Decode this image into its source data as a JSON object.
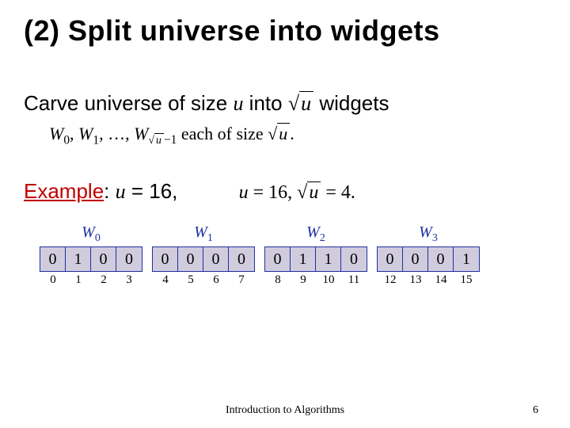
{
  "title": "(2) Split universe into widgets",
  "line1": {
    "pre": "Carve universe of size ",
    "u": "u",
    "mid": " into ",
    "sqrt_arg": "u",
    "post": " widgets"
  },
  "line2": {
    "w": "W",
    "sep": ", ",
    "ellipsis": "…",
    "each": " each of size ",
    "sqrt_arg": "u",
    "period": "."
  },
  "example": {
    "label": "Example",
    "colon": ": ",
    "u": "u",
    "eq": " = 16,",
    "tail_u": "u",
    "tail_eq": " = 16, ",
    "tail_sqrt_arg": "u",
    "tail_eq2": " = 4."
  },
  "widgets": [
    {
      "label_sub": "0",
      "values": [
        "0",
        "1",
        "0",
        "0"
      ],
      "indices": [
        "0",
        "1",
        "2",
        "3"
      ]
    },
    {
      "label_sub": "1",
      "values": [
        "0",
        "0",
        "0",
        "0"
      ],
      "indices": [
        "4",
        "5",
        "6",
        "7"
      ]
    },
    {
      "label_sub": "2",
      "values": [
        "0",
        "1",
        "1",
        "0"
      ],
      "indices": [
        "8",
        "9",
        "10",
        "11"
      ]
    },
    {
      "label_sub": "3",
      "values": [
        "0",
        "0",
        "0",
        "1"
      ],
      "indices": [
        "12",
        "13",
        "14",
        "15"
      ]
    }
  ],
  "widget_letter": "W",
  "footer": "Introduction to Algorithms",
  "page": "6"
}
